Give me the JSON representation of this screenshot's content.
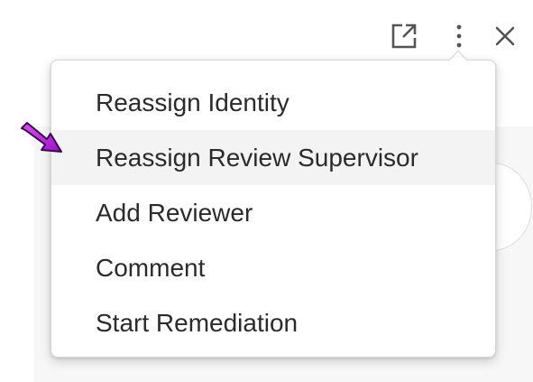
{
  "toolbar": {
    "open_external_icon": "open-in-new-window-icon",
    "more_icon": "vertical-ellipsis-icon",
    "close_icon": "close-x-icon"
  },
  "menu": {
    "items": [
      {
        "label": "Reassign Identity"
      },
      {
        "label": "Reassign Review Supervisor",
        "highlighted": true
      },
      {
        "label": "Add Reviewer"
      },
      {
        "label": "Comment"
      },
      {
        "label": "Start Remediation"
      }
    ]
  },
  "annotation": {
    "pointer_color": "#c21fe6",
    "pointer_target": "Reassign Review Supervisor"
  },
  "colors": {
    "icon": "#555555",
    "text": "#2b2b2b",
    "hover_bg": "#f3f3f3"
  }
}
